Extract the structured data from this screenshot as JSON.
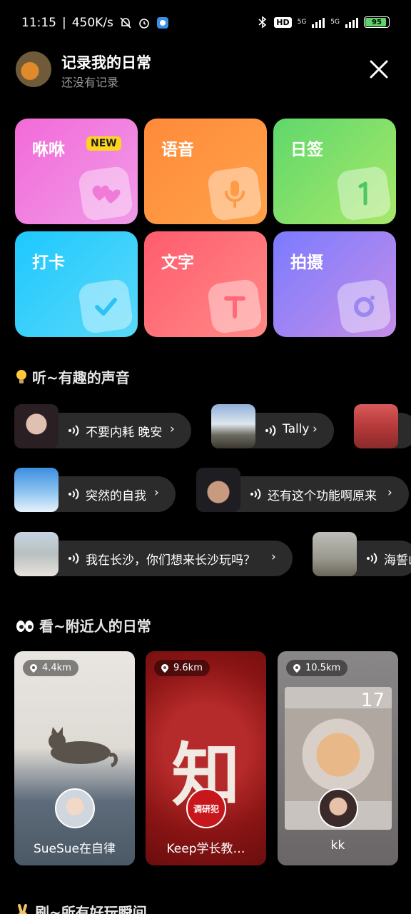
{
  "status_bar": {
    "time": "11:15",
    "speed": "450K/s",
    "hd": "HD",
    "net1": "5G",
    "net2": "5G",
    "battery_level": 95,
    "battery_text": "95"
  },
  "header": {
    "title": "记录我的日常",
    "subtitle": "还没有记录"
  },
  "tiles": [
    {
      "label": "咻咻",
      "badge": "NEW",
      "icon": "hearts-icon"
    },
    {
      "label": "语音",
      "icon": "microphone-icon"
    },
    {
      "label": "日签",
      "icon": "number-one-icon"
    },
    {
      "label": "打卡",
      "icon": "check-icon"
    },
    {
      "label": "文字",
      "icon": "text-t-icon"
    },
    {
      "label": "拍摄",
      "icon": "camera-icon"
    }
  ],
  "sections": {
    "listen": "听~有趣的声音",
    "nearby": "看~附近人的日常",
    "browse": "刷~所有好玩瞬间"
  },
  "audio_chips": [
    {
      "text": "不要内耗 晚安"
    },
    {
      "text": "Tally"
    },
    {
      "text": ""
    },
    {
      "text": "突然的自我"
    },
    {
      "text": "还有这个功能啊原来"
    },
    {
      "text": "我在长沙，你们想来长沙玩吗？"
    },
    {
      "text": "海誓山"
    }
  ],
  "nearby_cards": [
    {
      "distance": "4.4km",
      "name": "SueSue在自律"
    },
    {
      "distance": "9.6km",
      "name": "Keep学长教…",
      "poster_char": "知",
      "seal_text": "调研犯"
    },
    {
      "distance": "10.5km",
      "name": "kk",
      "overlay_num": "17"
    }
  ]
}
